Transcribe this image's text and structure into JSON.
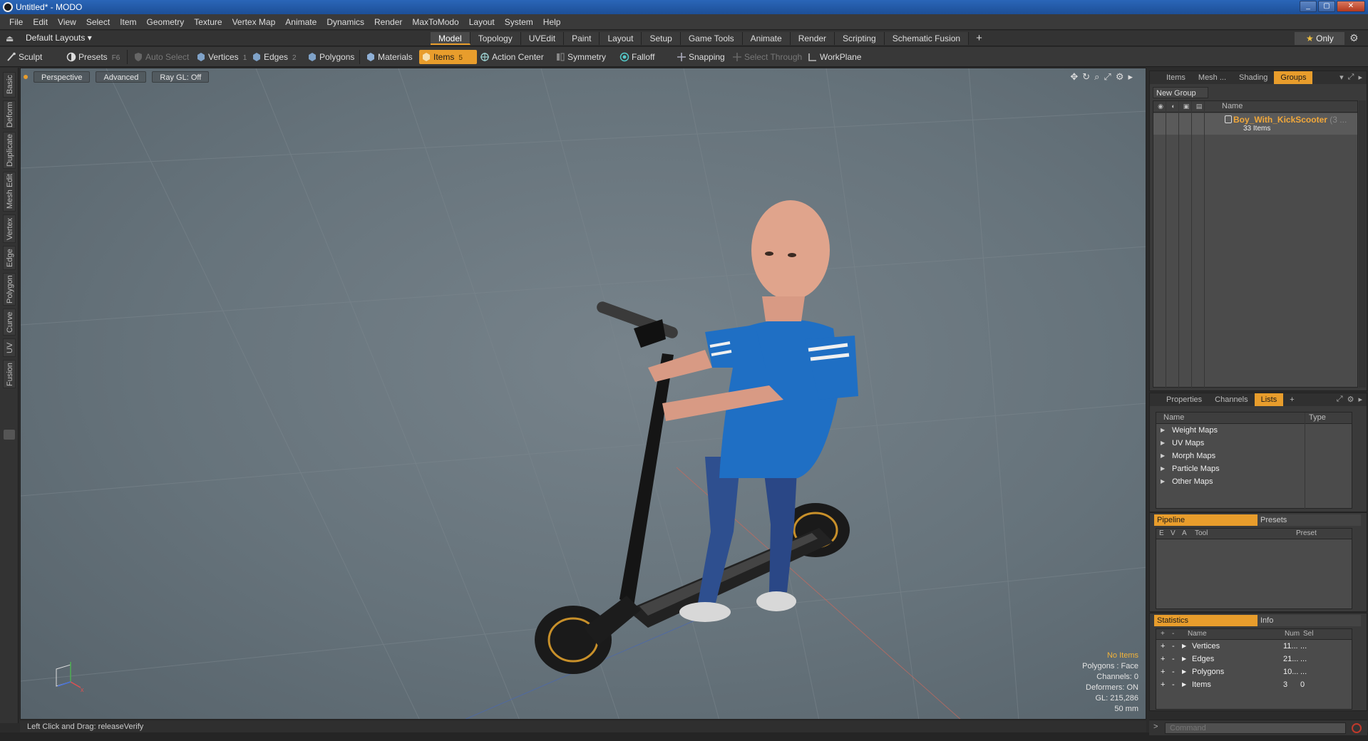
{
  "window": {
    "title": "Untitled* - MODO",
    "buttons": [
      "_",
      "▢",
      "✕"
    ]
  },
  "menu": [
    "File",
    "Edit",
    "View",
    "Select",
    "Item",
    "Geometry",
    "Texture",
    "Vertex Map",
    "Animate",
    "Dynamics",
    "Render",
    "MaxToModo",
    "Layout",
    "System",
    "Help"
  ],
  "layoutbar": {
    "layouts_label": "Default Layouts ▾",
    "tabs": [
      "Model",
      "Topology",
      "UVEdit",
      "Paint",
      "Layout",
      "Setup",
      "Game Tools",
      "Animate",
      "Render",
      "Scripting",
      "Schematic Fusion"
    ],
    "active_tab": "Model",
    "add_label": "+",
    "only_label": "Only"
  },
  "toolbar": {
    "sculpt": "Sculpt",
    "presets": "Presets",
    "presets_key": "F6",
    "auto_select": "Auto Select",
    "vertices": "Vertices",
    "vertices_key": "1",
    "edges": "Edges",
    "edges_key": "2",
    "polygons": "Polygons",
    "materials": "Materials",
    "items": "Items",
    "items_key": "5",
    "action_center": "Action Center",
    "symmetry": "Symmetry",
    "falloff": "Falloff",
    "snapping": "Snapping",
    "select_through": "Select Through",
    "workplane": "WorkPlane"
  },
  "left_tabs": [
    "Basic",
    "Deform",
    "Duplicate",
    "Mesh Edit",
    "Vertex",
    "Edge",
    "Polygon",
    "Curve",
    "UV",
    "Fusion"
  ],
  "viewport": {
    "view": "Perspective",
    "shading": "Advanced",
    "raygl": "Ray GL: Off",
    "stats": {
      "selection": "No Items",
      "polygons": "Polygons : Face",
      "channels": "Channels: 0",
      "deformers": "Deformers: ON",
      "gl": "GL: 215,286",
      "unit": "50 mm"
    }
  },
  "statusbar": {
    "text": "Left Click and Drag:   releaseVerify"
  },
  "groups_panel": {
    "tabs": [
      "Items",
      "Mesh ...",
      "Shading",
      "Groups"
    ],
    "active_tab": "Groups",
    "new_group": "New Group",
    "name_header": "Name",
    "group_name": "Boy_With_KickScooter",
    "group_suffix": "(3 ...",
    "group_count": "33 Items"
  },
  "lists_panel": {
    "tabs": [
      "Properties",
      "Channels",
      "Lists"
    ],
    "active_tab": "Lists",
    "add": "+",
    "head_name": "Name",
    "head_type": "Type",
    "rows": [
      "Weight Maps",
      "UV Maps",
      "Morph Maps",
      "Particle Maps",
      "Other Maps"
    ]
  },
  "pipeline_panel": {
    "tab_pipeline": "Pipeline",
    "tab_presets": "Presets",
    "head_e": "E",
    "head_v": "V",
    "head_a": "A",
    "head_tool": "Tool",
    "head_preset": "Preset"
  },
  "stats_panel": {
    "tab_statistics": "Statistics",
    "tab_info": "Info",
    "head_plus": "+",
    "head_minus": "-",
    "head_name": "Name",
    "head_num": "Num",
    "head_sel": "Sel",
    "rows": [
      {
        "name": "Vertices",
        "num": "11...",
        "sel": "..."
      },
      {
        "name": "Edges",
        "num": "21...",
        "sel": "..."
      },
      {
        "name": "Polygons",
        "num": "10...",
        "sel": "..."
      },
      {
        "name": "Items",
        "num": "3",
        "sel": "0"
      }
    ]
  },
  "command": {
    "prompt": ">",
    "placeholder": "Command"
  },
  "colors": {
    "accent": "#e89d2c",
    "titlebar": "#2a66b8",
    "viewport": "#6b7880"
  }
}
